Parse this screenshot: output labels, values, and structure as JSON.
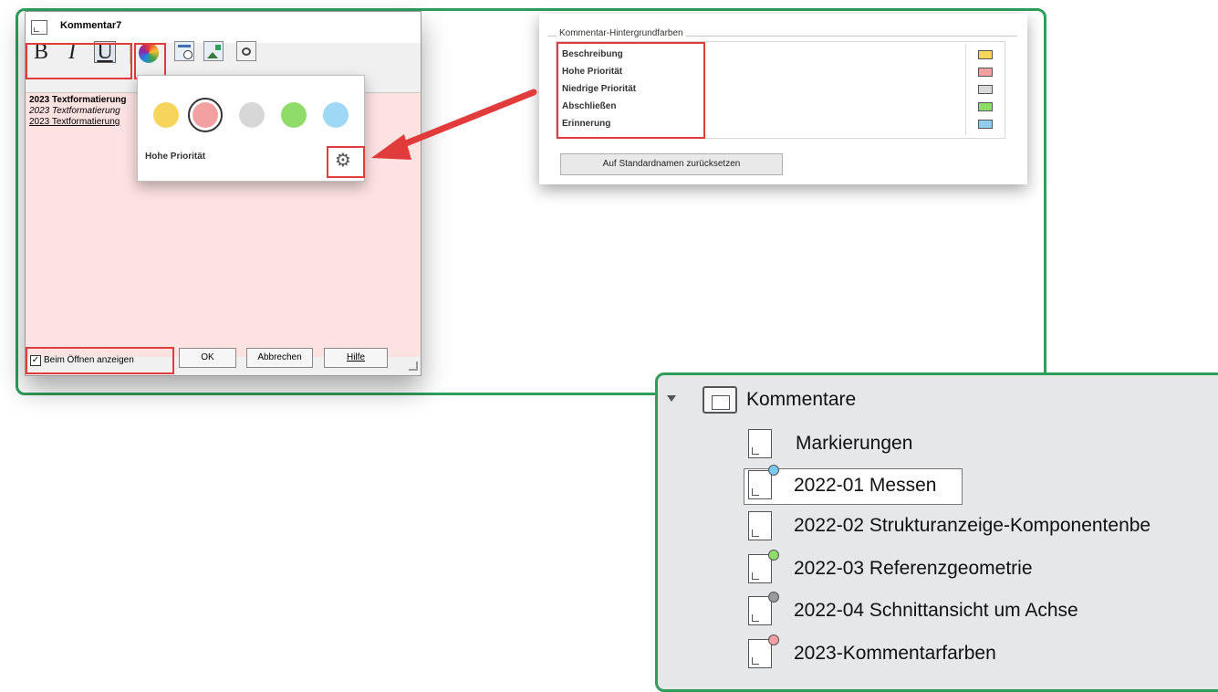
{
  "dialog": {
    "title": "Kommentar7",
    "toolbar": {
      "bold_label": "B",
      "italic_label": "I",
      "underline_label": "U"
    },
    "editor_lines": [
      "2023 Textformatierung",
      "2023 Textformatierung",
      "2023 Textformatierung"
    ],
    "show_on_open_label": "Beim Öffnen anzeigen",
    "show_on_open_checked": true,
    "ok_label": "OK",
    "cancel_label": "Abbrechen",
    "help_label": "Hilfe"
  },
  "color_popover": {
    "swatches": [
      {
        "name": "Beschreibung",
        "color": "#f7d55c"
      },
      {
        "name": "Hohe Priorität",
        "color": "#f2a0a0",
        "selected": true
      },
      {
        "name": "Niedrige Priorität",
        "color": "#d7d7d7"
      },
      {
        "name": "Abschließen",
        "color": "#8fdc6a"
      },
      {
        "name": "Erinnerung",
        "color": "#9fd8f7"
      }
    ],
    "selected_label": "Hohe Priorität"
  },
  "settings": {
    "group_title": "Kommentar-Hintergrundfarben",
    "rows": [
      {
        "label": "Beschreibung",
        "color": "#f7d55c"
      },
      {
        "label": "Hohe Priorität",
        "color": "#f2a0a0"
      },
      {
        "label": "Niedrige Priorität",
        "color": "#d9d9d9"
      },
      {
        "label": "Abschließen",
        "color": "#8fdc6a"
      },
      {
        "label": "Erinnerung",
        "color": "#8fd0ef"
      }
    ],
    "reset_label": "Auf Standardnamen zurücksetzen"
  },
  "tree": {
    "root_label": "Kommentare",
    "items": [
      {
        "label": "Markierungen",
        "dot": null
      },
      {
        "label": "2022-01 Messen",
        "dot": "#7cc8f2",
        "selected": true
      },
      {
        "label": "2022-02 Strukturanzeige-Komponentenbe",
        "dot": null
      },
      {
        "label": "2022-03 Referenzgeometrie",
        "dot": "#8fdc6a"
      },
      {
        "label": "2022-04 Schnittansicht um Achse",
        "dot": "#9a9a9a"
      },
      {
        "label": "2023-Kommentarfarben",
        "dot": "#f2a0a0"
      }
    ]
  },
  "colors": {
    "frame": "#2e9e5b",
    "highlight": "#e23b3b",
    "arrow": "#e23b3b"
  }
}
